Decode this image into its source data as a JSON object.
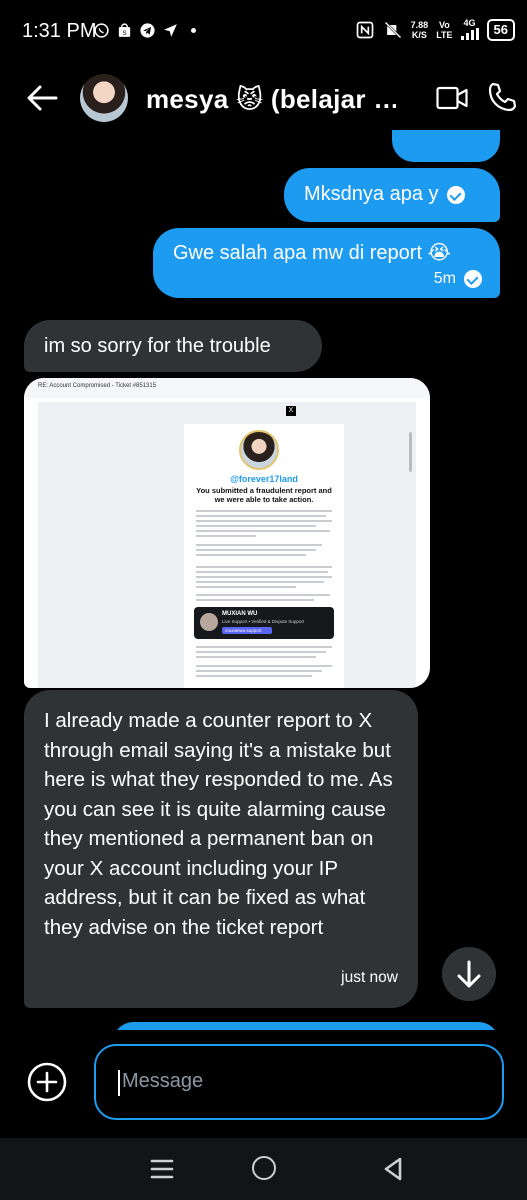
{
  "status_bar": {
    "time": "1:31 PM",
    "speed_value": "7.88",
    "speed_unit": "K/S",
    "volte_top": "Vo",
    "volte_bottom": "LTE",
    "network": "4G",
    "battery": "56",
    "icons": [
      "whatsapp-icon",
      "shopping-icon",
      "telegram-icon",
      "location-arrow-icon",
      "dot-icon",
      "nfc-icon",
      "mute-icon",
      "signal-icon"
    ]
  },
  "header": {
    "contact_name": "mesya 😾 (belajar …",
    "icons": [
      "back-arrow-icon",
      "video-call-icon",
      "phone-icon"
    ]
  },
  "messages": [
    {
      "direction": "sent",
      "text": "Mksdnya apa y",
      "status": "read"
    },
    {
      "direction": "sent",
      "text": "Gwe salah apa mw di report 😭",
      "time": "5m",
      "status": "read"
    },
    {
      "direction": "received",
      "text": "im so sorry for the trouble"
    },
    {
      "direction": "received",
      "type": "image"
    },
    {
      "direction": "received",
      "text": "I already made a counter report to X through email saying it's a mistake but here is what they responded to me. As you can see it is quite alarming cause they mentioned a permanent ban on your X account including your IP address, but it can be fixed as what they advise on the ticket report",
      "time": "just now"
    }
  ],
  "image": {
    "subject": "RE: Account Compromised - Ticket #851315",
    "handle": "@forever17land",
    "title": "You submitted a fraudulent report and we were able to take action.",
    "card_name": "MUXIAN WU",
    "card_sub": "Live Support • Verified & Dispute Support",
    "card_button": "muxianwu.support"
  },
  "composer": {
    "placeholder": "Message"
  },
  "colors": {
    "accent": "#1d9bf0",
    "received_bubble": "#2f3336",
    "background": "#000000"
  }
}
